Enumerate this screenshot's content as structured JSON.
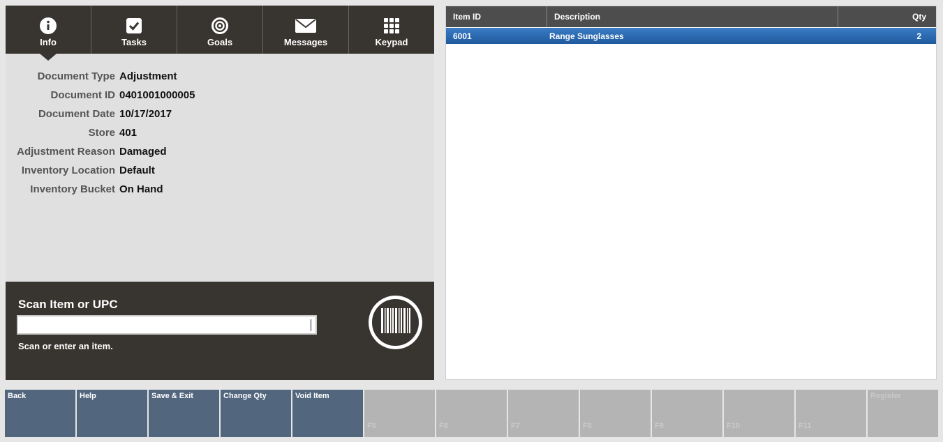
{
  "tabs": [
    {
      "label": "Info",
      "icon": "info-icon"
    },
    {
      "label": "Tasks",
      "icon": "checkbox-icon"
    },
    {
      "label": "Goals",
      "icon": "target-icon"
    },
    {
      "label": "Messages",
      "icon": "envelope-icon"
    },
    {
      "label": "Keypad",
      "icon": "keypad-icon"
    }
  ],
  "info": [
    {
      "label": "Document Type",
      "value": "Adjustment"
    },
    {
      "label": "Document ID",
      "value": "0401001000005"
    },
    {
      "label": "Document Date",
      "value": "10/17/2017"
    },
    {
      "label": "Store",
      "value": "401"
    },
    {
      "label": "Adjustment Reason",
      "value": "Damaged"
    },
    {
      "label": "Inventory Location",
      "value": "Default"
    },
    {
      "label": "Inventory Bucket",
      "value": "On Hand"
    }
  ],
  "scan": {
    "title": "Scan Item or UPC",
    "value": "",
    "hint": "Scan or enter an item."
  },
  "table": {
    "headers": {
      "item_id": "Item ID",
      "description": "Description",
      "qty": "Qty"
    },
    "rows": [
      {
        "item_id": "6001",
        "description": "Range Sunglasses",
        "qty": "2"
      }
    ]
  },
  "function_keys": [
    {
      "label": "Back",
      "enabled": true
    },
    {
      "label": "Help",
      "enabled": true
    },
    {
      "label": "Save & Exit",
      "enabled": true
    },
    {
      "label": "Change Qty",
      "enabled": true
    },
    {
      "label": "Void Item",
      "enabled": true
    },
    {
      "label": "F5",
      "enabled": false
    },
    {
      "label": "F6",
      "enabled": false
    },
    {
      "label": "F7",
      "enabled": false
    },
    {
      "label": "F8",
      "enabled": false
    },
    {
      "label": "F9",
      "enabled": false
    },
    {
      "label": "F10",
      "enabled": false
    },
    {
      "label": "F11",
      "enabled": false
    },
    {
      "label": "Register",
      "enabled": false
    }
  ],
  "colors": {
    "dark_panel": "#38342f",
    "selected_row": "#2a6bb3",
    "fkey_active": "#52667e",
    "fkey_inactive": "#b4b4b4"
  }
}
